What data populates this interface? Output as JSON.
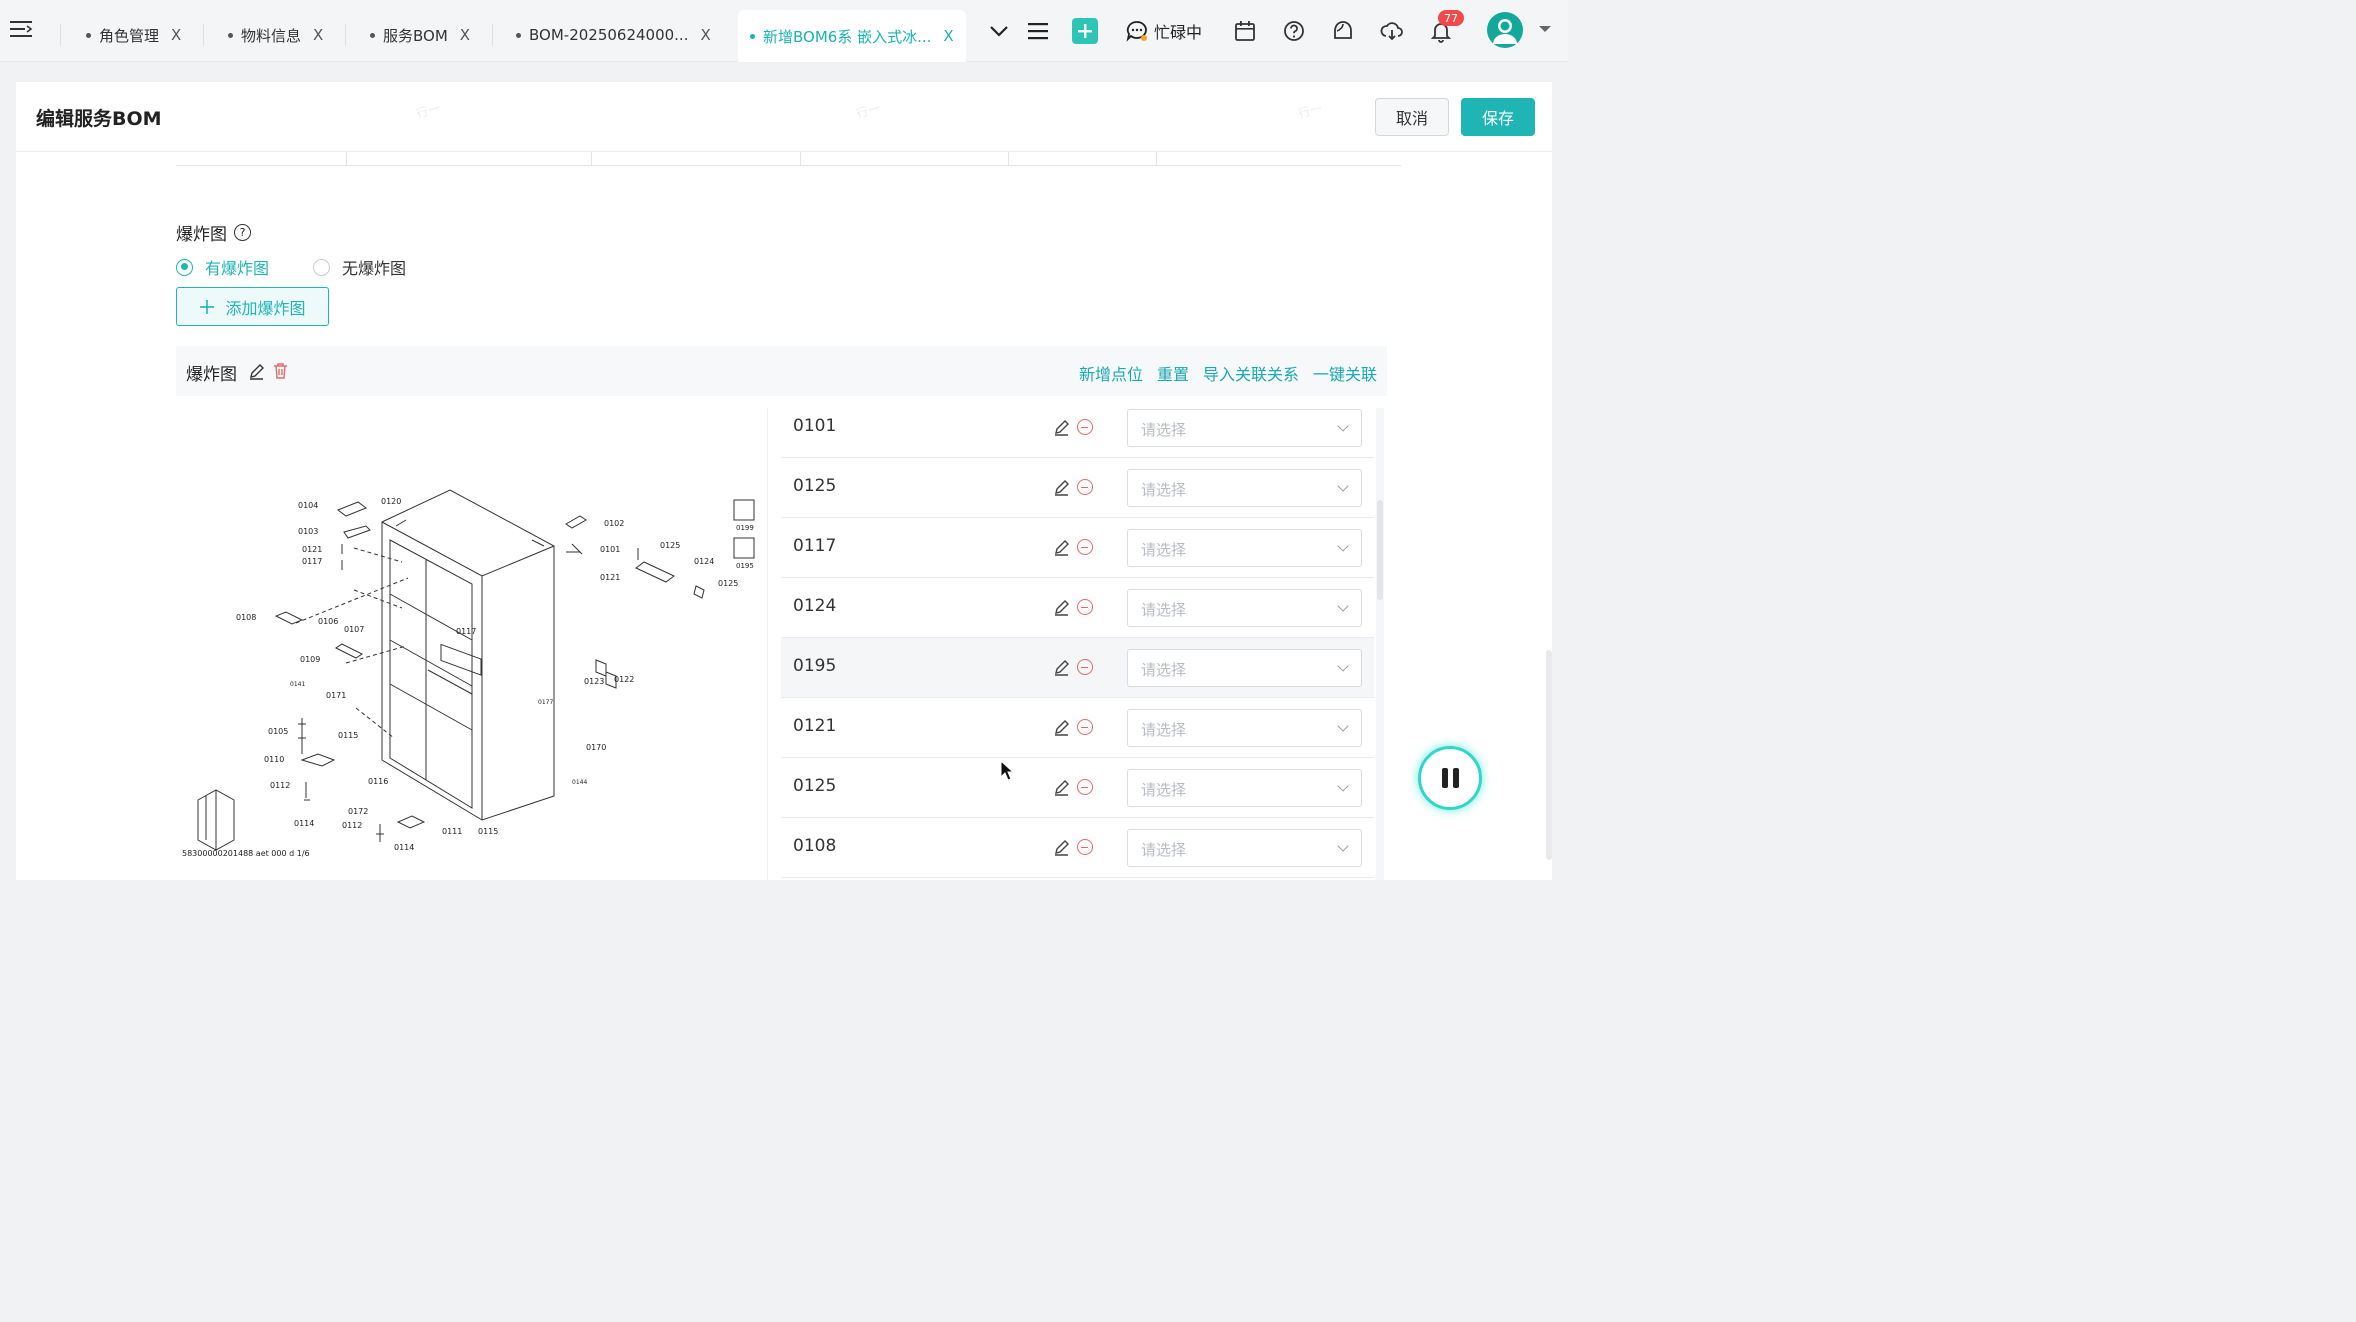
{
  "tabs": [
    {
      "label": "角色管理",
      "close": "X"
    },
    {
      "label": "物料信息",
      "close": "X"
    },
    {
      "label": "服务BOM",
      "close": "X"
    },
    {
      "label": "BOM-20250624000...",
      "close": "X"
    },
    {
      "label": "新增BOM6系 嵌入式冰...",
      "close": "X",
      "active": true
    }
  ],
  "toolbar": {
    "status_label": "忙碌中",
    "notification_count": "77"
  },
  "page": {
    "title": "编辑服务BOM",
    "cancel_label": "取消",
    "save_label": "保存"
  },
  "explode": {
    "section_label": "爆炸图",
    "help_glyph": "?",
    "option_yes": "有爆炸图",
    "option_no": "无爆炸图",
    "selected": "有爆炸图",
    "add_button_label": "添加爆炸图",
    "panel_title": "爆炸图",
    "actions": [
      "新增点位",
      "重置",
      "导入关联关系",
      "一键关联"
    ]
  },
  "diagram_labels": {
    "l0104": "0104",
    "l0120": "0120",
    "l0103": "0103",
    "l0121a": "0121",
    "l0117a": "0117",
    "l0108": "0108",
    "l0106": "0106",
    "l0107": "0107",
    "l0109": "0109",
    "l0141": "0141",
    "l0171": "0171",
    "l0105": "0105",
    "l0115a": "0115",
    "l0110": "0110",
    "l0112a": "0112",
    "l0116": "0116",
    "l0114a": "0114",
    "l0172": "0172",
    "l0112b": "0112",
    "l0111": "0111",
    "l0115b": "0115",
    "l0114b": "0114",
    "l0117b": "0117",
    "l0177": "0177",
    "l0170": "0170",
    "l0144": "0144",
    "l0102": "0102",
    "l0101": "0101",
    "l0121b": "0121",
    "l0125a": "0125",
    "l0124": "0124",
    "l0125b": "0125",
    "l0199": "0199",
    "l0195": "0195",
    "l0123": "0123",
    "l0122": "0122",
    "caption": "58300000201488 aet 000 d 1/6"
  },
  "rows": [
    {
      "code": "0101",
      "placeholder": "请选择"
    },
    {
      "code": "0125",
      "placeholder": "请选择"
    },
    {
      "code": "0117",
      "placeholder": "请选择"
    },
    {
      "code": "0124",
      "placeholder": "请选择"
    },
    {
      "code": "0195",
      "placeholder": "请选择",
      "highlighted": true
    },
    {
      "code": "0121",
      "placeholder": "请选择"
    },
    {
      "code": "0125",
      "placeholder": "请选择"
    },
    {
      "code": "0108",
      "placeholder": "请选择"
    }
  ],
  "watermark": "行一",
  "colors": {
    "accent": "#1fb5b5",
    "danger": "#e46a6a",
    "badge": "#f04a4a"
  }
}
